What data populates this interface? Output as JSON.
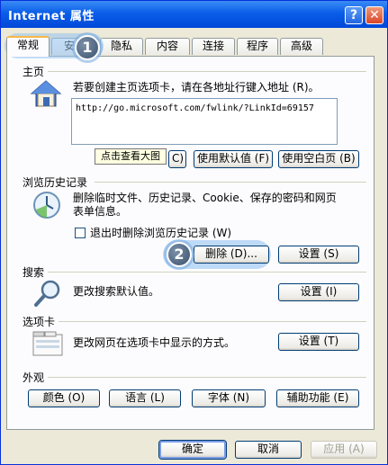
{
  "window": {
    "title": "Internet 属性",
    "help_label": "?",
    "close_label": "✕"
  },
  "tabs": [
    {
      "label": "常规"
    },
    {
      "label": "安全"
    },
    {
      "label": "隐私"
    },
    {
      "label": "内容"
    },
    {
      "label": "连接"
    },
    {
      "label": "程序"
    },
    {
      "label": "高级"
    }
  ],
  "home": {
    "group_label": "主页",
    "instruction": "若要创建主页选项卡，请在各地址行键入地址 (R)。",
    "url": "http://go.microsoft.com/fwlink/?LinkId=69157",
    "use_current_fragment": "C)",
    "use_default_label": "使用默认值 (F)",
    "use_blank_label": "使用空白页 (B)",
    "tooltip": "点击查看大图"
  },
  "history": {
    "group_label": "浏览历史记录",
    "description_line1": "删除临时文件、历史记录、Cookie、保存的密码和网页",
    "description_line2": "表单信息。",
    "checkbox_label": "退出时删除浏览历史记录 (W)",
    "delete_label": "删除 (D)...",
    "settings_label": "设置 (S)"
  },
  "search": {
    "group_label": "搜索",
    "description": "更改搜索默认值。",
    "settings_label": "设置 (I)"
  },
  "tabs_section": {
    "group_label": "选项卡",
    "description": "更改网页在选项卡中显示的方式。",
    "settings_label": "设置 (T)"
  },
  "appearance": {
    "group_label": "外观",
    "colors_label": "颜色 (O)",
    "languages_label": "语言 (L)",
    "fonts_label": "字体 (N)",
    "accessibility_label": "辅助功能 (E)"
  },
  "footer": {
    "ok_label": "确定",
    "cancel_label": "取消",
    "apply_label": "应用 (A)"
  },
  "callouts": {
    "step1": "1",
    "step2": "2"
  },
  "colors": {
    "titlebar": "#0a5ee8",
    "dialog_bg": "#ece9d8",
    "panel_bg": "#fcfcfe",
    "callout_badge": "#3d526c",
    "callout_glow": "#96c3f0"
  }
}
